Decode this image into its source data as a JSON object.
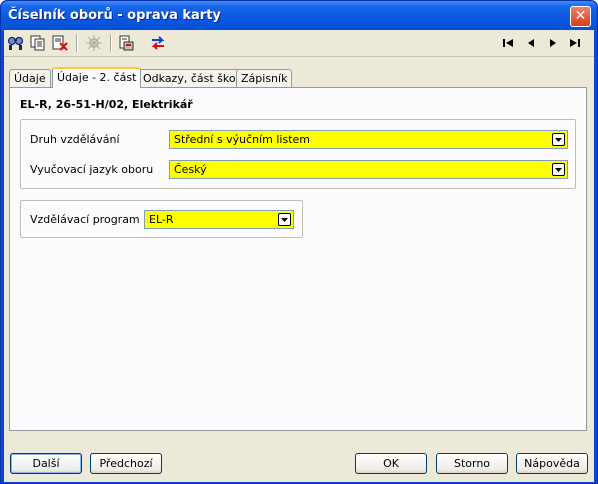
{
  "window": {
    "title": "Číselník oborů - oprava karty",
    "close_glyph": "✕"
  },
  "toolbar": {
    "icons": [
      "find-icon",
      "copy-record-icon",
      "delete-record-icon",
      "settings-disabled-icon",
      "print-icon",
      "transfer-icon"
    ],
    "nav": {
      "first": "first-record-icon",
      "prev": "previous-record-icon",
      "next": "next-record-icon",
      "last": "last-record-icon"
    }
  },
  "tabs": [
    {
      "label": "Údaje"
    },
    {
      "label": "Údaje - 2. část"
    },
    {
      "label": "Odkazy, část školy"
    },
    {
      "label": "Zápisník"
    }
  ],
  "panel": {
    "heading": "EL-R, 26-51-H/02, Elektrikář",
    "fields": {
      "druh": {
        "label": "Druh vzdělávání",
        "value": "Střední s výučním listem"
      },
      "jazyk": {
        "label": "Vyučovací jazyk oboru",
        "value": "Český"
      },
      "program": {
        "label": "Vzdělávací program",
        "value": "EL-R"
      }
    }
  },
  "buttons": {
    "next": "Další",
    "prev": "Předchozí",
    "ok": "OK",
    "cancel": "Storno",
    "help": "Nápověda"
  },
  "colors": {
    "field_highlight": "#ffff00",
    "titlebar": "#0a58e0",
    "dialog_bg": "#ece9d8"
  }
}
